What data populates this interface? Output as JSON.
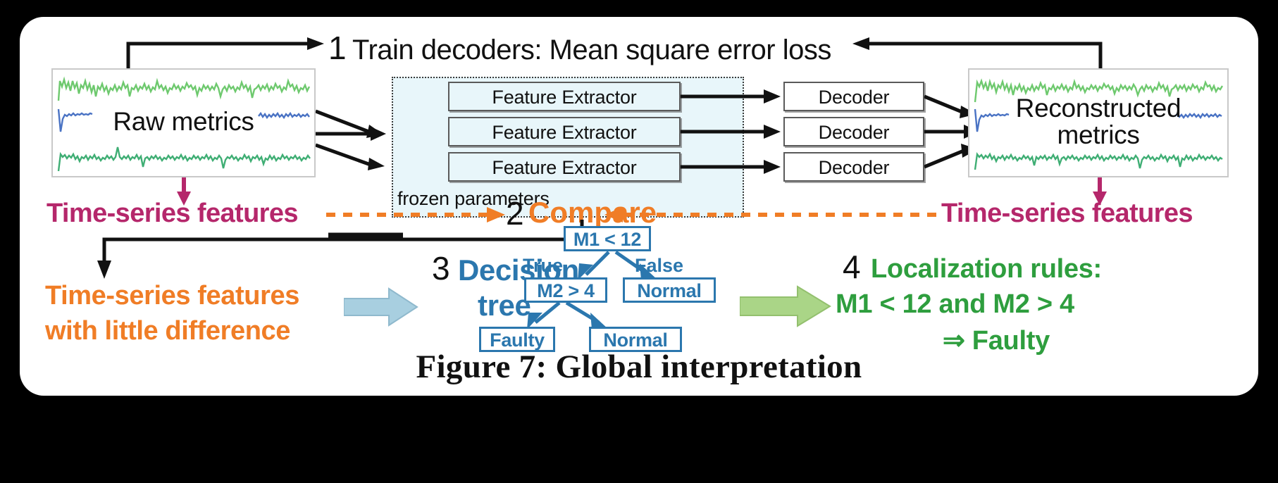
{
  "figure": {
    "caption": "Figure 7: Global interpretation",
    "background_color": "#000000",
    "card_color": "#ffffff"
  },
  "colors": {
    "magenta": "#b5276b",
    "orange": "#f07d26",
    "blue": "#2b77ae",
    "green": "#2e9e3e",
    "green_arrow": "#aad587",
    "blue_arrow": "#a8cfe0",
    "feature_box_fill": "#e8f6fa",
    "wave_green_light": "#6ec96e",
    "wave_green_dark": "#3fae74",
    "wave_blue": "#4a73c4"
  },
  "steps": {
    "step1": {
      "number": "1",
      "text": "Train decoders: Mean square error loss"
    },
    "step2": {
      "number": "2",
      "text": "Compare"
    },
    "step3": {
      "number": "3",
      "line1": "Decision",
      "line2": "tree"
    },
    "step4": {
      "number": "4",
      "line1": "Localization rules:",
      "line2": "M1 < 12 and M2 > 4",
      "line3": "⇒ Faulty"
    }
  },
  "pipeline": {
    "raw_metrics_label": "Raw metrics",
    "reconstructed_label_line1": "Reconstructed",
    "reconstructed_label_line2": "metrics",
    "feature_extractors": [
      "Feature Extractor",
      "Feature Extractor",
      "Feature Extractor"
    ],
    "decoders": [
      "Decoder",
      "Decoder",
      "Decoder"
    ],
    "frozen_label": "frozen parameters"
  },
  "annotations": {
    "left_features": "Time-series features",
    "right_features": "Time-series features",
    "little_difference_line1": "Time-series features",
    "little_difference_line2": "with little difference"
  },
  "decision_tree": {
    "root": "M1 < 12",
    "edge_true": "True",
    "edge_false": "False",
    "node_left": "M2 > 4",
    "node_right": "Normal",
    "leaf_left": "Faulty",
    "leaf_right": "Normal"
  }
}
